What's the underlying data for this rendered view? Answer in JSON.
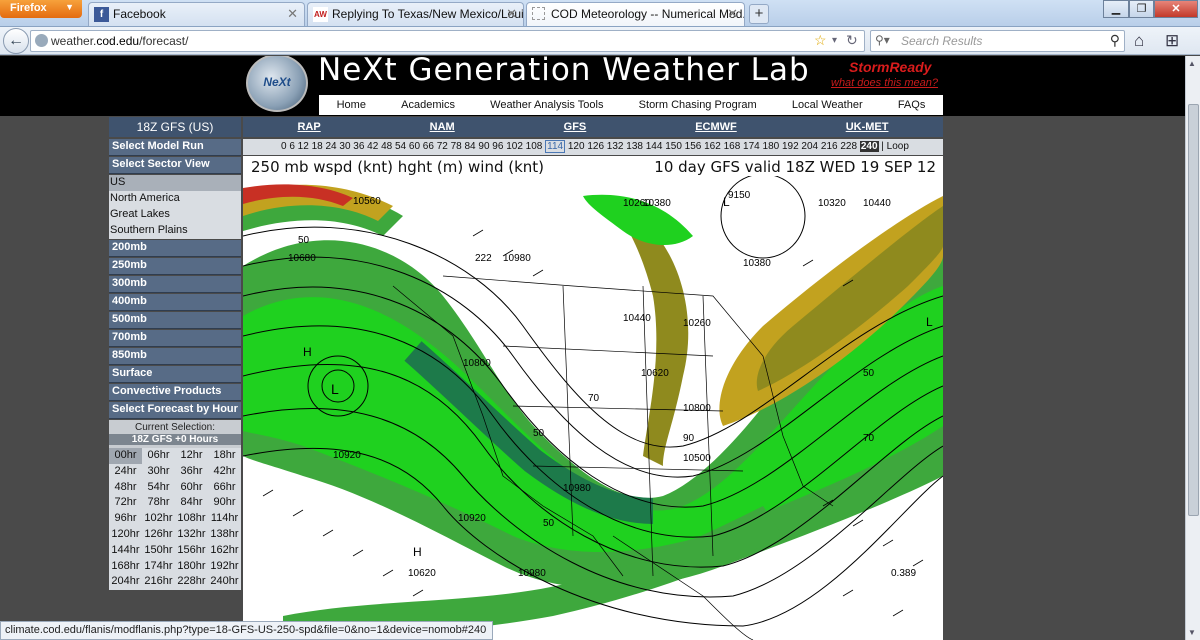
{
  "browser": {
    "firefox_label": "Firefox",
    "tabs": [
      {
        "title": "Facebook",
        "favicon": "f"
      },
      {
        "title": "Replying To Texas/New Mexico/Louis...",
        "favicon": "AW"
      },
      {
        "title": "COD Meteorology -- Numerical Mod...",
        "favicon": ""
      }
    ],
    "url_prefix": "weather.",
    "url_host": "cod.edu",
    "url_path": "/forecast/",
    "search_placeholder": "Search Results",
    "status_text": "climate.cod.edu/flanis/modflanis.php?type=18-GFS-US-250-spd&file=0&no=1&device=nomob#240"
  },
  "site": {
    "logo_text": "NeXt LAB",
    "title": "NeXt Generation Weather Lab",
    "stormready": "StormReady",
    "stormready_note": "what does this mean?",
    "nav": [
      "Home",
      "Academics",
      "Weather Analysis Tools",
      "Storm Chasing Program",
      "Local Weather",
      "FAQs"
    ]
  },
  "sidebar": {
    "model_title": "18Z GFS (US)",
    "select_model_run": "Select Model Run",
    "select_sector": "Select Sector View",
    "sectors": [
      "US",
      "North America",
      "Great Lakes",
      "Southern Plains"
    ],
    "selected_sector": "US",
    "levels": [
      "200mb",
      "250mb",
      "300mb",
      "400mb",
      "500mb",
      "700mb",
      "850mb",
      "Surface",
      "Convective Products"
    ],
    "select_forecast_hour": "Select Forecast by Hour",
    "current_selection_label": "Current Selection:",
    "current_selection_value": "18Z GFS +0 Hours",
    "hours": [
      "00hr",
      "06hr",
      "12hr",
      "18hr",
      "24hr",
      "30hr",
      "36hr",
      "42hr",
      "48hr",
      "54hr",
      "60hr",
      "66hr",
      "72hr",
      "78hr",
      "84hr",
      "90hr",
      "96hr",
      "102hr",
      "108hr",
      "114hr",
      "120hr",
      "126hr",
      "132hr",
      "138hr",
      "144hr",
      "150hr",
      "156hr",
      "162hr",
      "168hr",
      "174hr",
      "180hr",
      "192hr",
      "204hr",
      "216hr",
      "228hr",
      "240hr"
    ],
    "selected_hour": "00hr"
  },
  "models": [
    "RAP",
    "NAM",
    "GFS",
    "ECMWF",
    "UK-MET"
  ],
  "forecast_hours_bar": {
    "hours_before": "0 6 12 18 24 30 36 42 48 54 60 66 72 78 84 90 96 102 108",
    "current": "114",
    "hours_after": "120 126 132 138 144 150 156 162 168 174 180 192 204 216 228",
    "selected": "240",
    "loop_label": "| Loop"
  },
  "map": {
    "title_left": "250 mb wspd (knt) hght (m) wind (knt)",
    "title_right": "10 day GFS valid 18Z WED 19 SEP 12",
    "labels": [
      "10560",
      "10680",
      "10800",
      "10920",
      "10260",
      "10440",
      "10620",
      "10800",
      "10980",
      "10980",
      "10920",
      "222",
      "90",
      "50",
      "70",
      "50",
      "70",
      "50",
      "50",
      "L",
      "H",
      "H",
      "L",
      "L",
      "9150",
      "10260",
      "10380",
      "0.389",
      "10980",
      "10320",
      "10380",
      "10440",
      "10500",
      "10620"
    ],
    "colors": {
      "light_green": "#3ea83d",
      "bright_green": "#1fd11f",
      "dark_green": "#1d7a4a",
      "teal": "#2e6a5e",
      "olive": "#8f8a1e",
      "gold": "#c2a21f",
      "red": "#c83024"
    }
  }
}
